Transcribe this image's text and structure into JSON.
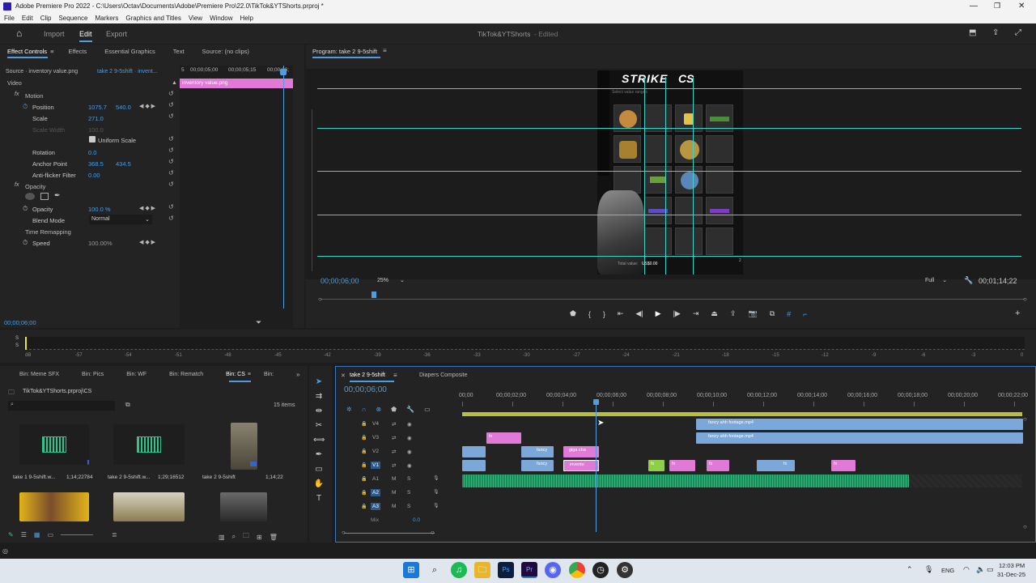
{
  "window": {
    "title": "Adobe Premiere Pro 2022 - C:\\Users\\Octav\\Documents\\Adobe\\Premiere Pro\\22.0\\TikTok&YTShorts.prproj *"
  },
  "menu": [
    "File",
    "Edit",
    "Clip",
    "Sequence",
    "Markers",
    "Graphics and Titles",
    "View",
    "Window",
    "Help"
  ],
  "workspace": {
    "tabs": [
      "Import",
      "Edit",
      "Export"
    ],
    "active": "Edit",
    "project_title": "TikTok&YTShorts",
    "project_status": "- Edited"
  },
  "effect_controls": {
    "tabs": [
      "Effect Controls",
      "Effects",
      "Essential Graphics",
      "Text",
      "Source: (no clips)"
    ],
    "source": "Source · inventory value.png",
    "sequence": "take 2 9-5shift · invent...",
    "ruler": [
      "5",
      "00;00;05;00",
      "00;00;05;15",
      "00;00;06;"
    ],
    "clip_bar": "inventory value.png",
    "video_header": "Video",
    "motion": "Motion",
    "position_label": "Position",
    "position_x": "1075.7",
    "position_y": "540.0",
    "scale_label": "Scale",
    "scale_val": "271.0",
    "scale_width_label": "Scale Width",
    "scale_width_val": "100.0",
    "uniform_scale": "Uniform Scale",
    "rotation_label": "Rotation",
    "rotation_val": "0.0",
    "anchor_label": "Anchor Point",
    "anchor_x": "368.5",
    "anchor_y": "434.5",
    "flicker_label": "Anti-flicker Filter",
    "flicker_val": "0.00",
    "opacity_header": "Opacity",
    "opacity_label": "Opacity",
    "opacity_val": "100.0 %",
    "blend_label": "Blend Mode",
    "blend_val": "Normal",
    "time_remap": "Time Remapping",
    "speed_label": "Speed",
    "speed_val": "100.00%",
    "timecode": "00;00;06;00"
  },
  "program": {
    "title": "Program: take 2 9-5shift",
    "timecode": "00;00;06;00",
    "zoom": "25%",
    "quality": "Full",
    "duration": "00;01;14;22",
    "overlay_title": "STRIKE",
    "overlay_sub": "Select value ranges",
    "total_value_label": "Total value:",
    "total_value": "US$0.00",
    "page_indicator": "2"
  },
  "audio_meter": {
    "db_labels": [
      "dB",
      "-57",
      "-54",
      "-51",
      "-48",
      "-45",
      "-42",
      "-39",
      "-36",
      "-33",
      "-30",
      "-27",
      "-24",
      "-21",
      "-18",
      "-15",
      "-12",
      "-9",
      "-6",
      "-3",
      "0"
    ],
    "channels": [
      "S",
      "S"
    ]
  },
  "project": {
    "bins": [
      "Bin: Meme SFX",
      "Bin: Pics",
      "Bin: WF",
      "Bin: Rematch",
      "Bin: CS",
      "Bin:"
    ],
    "active_bin": "Bin: CS",
    "path": "TikTok&YTShorts.prproj\\CS",
    "items_count": "15 items",
    "items": [
      {
        "name": "take 1 9-5shift.w...",
        "dur": "1;14;22784"
      },
      {
        "name": "take 2 9-5shift.w...",
        "dur": "1;29;16512"
      },
      {
        "name": "take 2 9-5shift",
        "dur": "1;14;22"
      }
    ]
  },
  "timeline": {
    "tabs": [
      "take 2 9-5shift",
      "Diapers Composite"
    ],
    "timecode": "00;00;06;00",
    "ruler": [
      "00;00",
      "00;00;02;00",
      "00;00;04;00",
      "00;00;06;00",
      "00;00;08;00",
      "00;00;10;00",
      "00;00;12;00",
      "00;00;14;00",
      "00;00;16;00",
      "00;00;18;00",
      "00;00;20;00",
      "00;00;22;00"
    ],
    "tracks": [
      "V4",
      "V3",
      "V2",
      "V1",
      "A1",
      "A2",
      "A3"
    ],
    "mix_label": "Mix",
    "mix_val": "0.0",
    "clips": {
      "fancy1": "fancy ahh footage.mp4",
      "fancy2": "fancy ahh footage.mp4",
      "fancy_v2": "fancy",
      "fancy_v1": "fancy",
      "giga": "giga cha",
      "invento": "invento",
      "fx1": "fx",
      "fx2": "fx",
      "fxv2": "fx",
      "fxv1a": "fx",
      "fxv1b": "fx",
      "fxv1c": "fx",
      "fxv1d": "fx",
      "fxv1e": "fx"
    }
  },
  "taskbar": {
    "lang": "ENG",
    "time": "12:03 PM",
    "date": "31-Dec-25"
  }
}
